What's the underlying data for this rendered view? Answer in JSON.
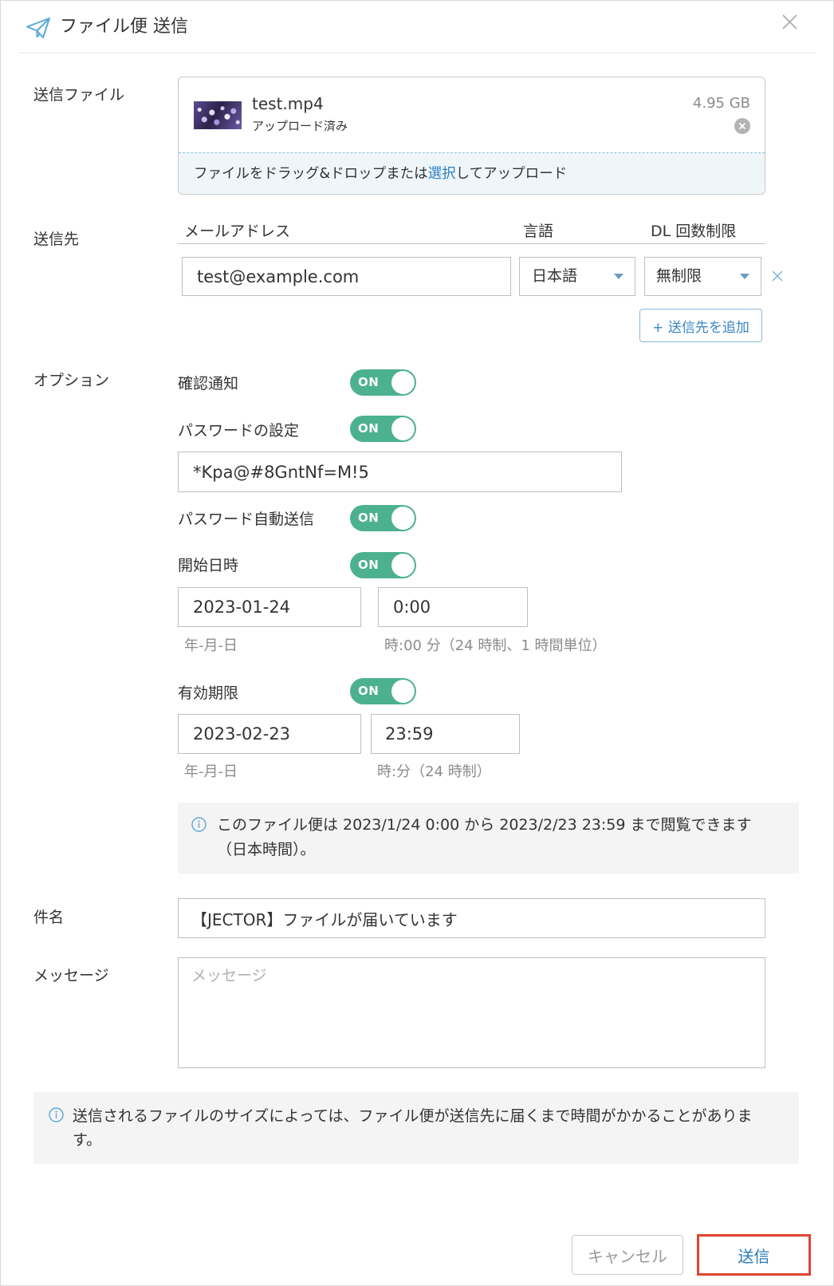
{
  "dialog": {
    "title": "ファイル便 送信",
    "title_icon": "paper-plane-icon",
    "close_icon": "close-icon"
  },
  "file_section": {
    "label": "送信ファイル",
    "file": {
      "name": "test.mp4",
      "status": "アップロード済み",
      "size": "4.95 GB",
      "remove_icon": "remove-circle-icon"
    },
    "dropzone": {
      "text_before": "ファイルをドラッグ&ドロップまたは",
      "link": "選択",
      "text_after": "してアップロード"
    }
  },
  "recipients": {
    "label": "送信先",
    "columns": {
      "email": "メールアドレス",
      "language": "言語",
      "dl_limit": "DL 回数制限"
    },
    "rows": [
      {
        "email": "test@example.com",
        "language": "日本語",
        "dl_limit": "無制限",
        "remove_icon": "close-icon"
      }
    ],
    "add_button": "+ 送信先を追加"
  },
  "options": {
    "label": "オプション",
    "read_notification": {
      "label": "確認通知",
      "toggle": "ON"
    },
    "password": {
      "label": "パスワードの設定",
      "toggle": "ON",
      "value": "*Kpa@#8GntNf=M!5"
    },
    "password_auto_send": {
      "label": "パスワード自動送信",
      "toggle": "ON"
    },
    "start": {
      "label": "開始日時",
      "toggle": "ON",
      "date": "2023-01-24",
      "time": "0:00",
      "date_hint": "年-月-日",
      "time_hint": "時:00 分（24 時制、1 時間単位）"
    },
    "expiry": {
      "label": "有効期限",
      "toggle": "ON",
      "date": "2023-02-23",
      "time": "23:59",
      "date_hint": "年-月-日",
      "time_hint": "時:分（24 時制）"
    },
    "notice": {
      "icon": "info-icon",
      "lines": [
        "このファイル便は 2023/1/24 0:00 から 2023/2/23 23:59 まで閲覧できます",
        "（日本時間）。"
      ]
    }
  },
  "subject": {
    "label": "件名",
    "value": "【JECTOR】ファイルが届いています"
  },
  "message": {
    "label": "メッセージ",
    "placeholder": "メッセージ"
  },
  "size_notice": {
    "icon": "info-icon",
    "lines": [
      "送信されるファイルのサイズによっては、ファイル便が送信先に届くまで時間がかかることがありま",
      "す。"
    ]
  },
  "footer": {
    "cancel_button": "キャンセル",
    "send_button": "送信"
  },
  "colors": {
    "toggle_on": "#4cb18f",
    "link": "#2d7fc0",
    "accent_icon": "#5aa8d6",
    "highlight": "#e0442f"
  }
}
